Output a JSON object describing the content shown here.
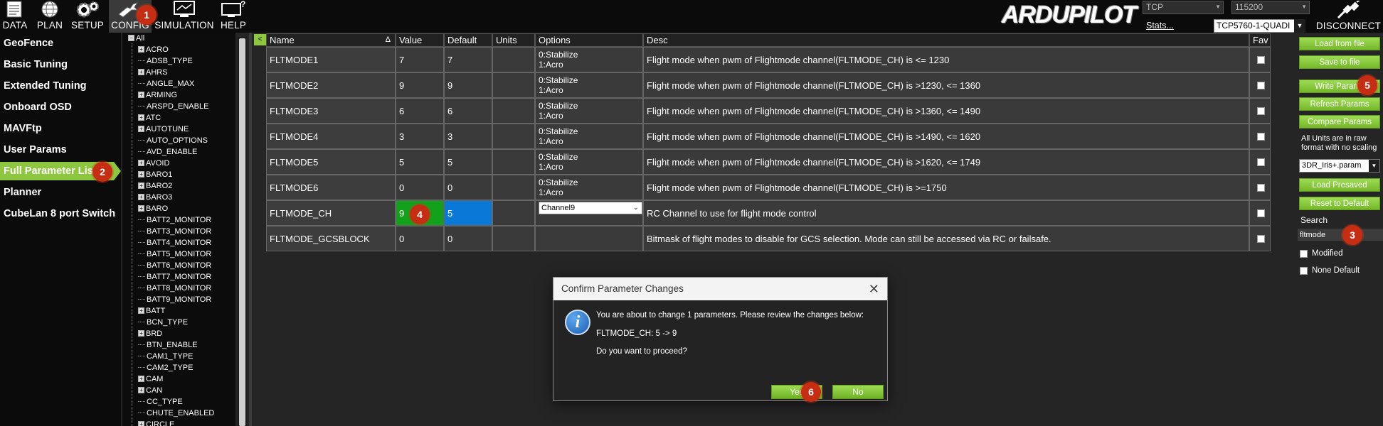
{
  "topbar": {
    "buttons": [
      {
        "label": "DATA",
        "icon": "data-icon"
      },
      {
        "label": "PLAN",
        "icon": "plan-globe-icon"
      },
      {
        "label": "SETUP",
        "icon": "setup-gear-icon"
      },
      {
        "label": "CONFIG",
        "icon": "config-wrench-icon",
        "active": true
      },
      {
        "label": "SIMULATION",
        "icon": "simulation-monitor-icon"
      },
      {
        "label": "HELP",
        "icon": "help-monitor-icon"
      }
    ],
    "logo": "ARDUPILOT",
    "connection_type": "TCP",
    "baud_rate": "115200",
    "stats_link": "Stats...",
    "connection_name": "TCP5760-1-QUADI",
    "disconnect_label": "DISCONNECT"
  },
  "left_menu": {
    "items": [
      {
        "label": "GeoFence"
      },
      {
        "label": "Basic Tuning"
      },
      {
        "label": "Extended Tuning"
      },
      {
        "label": "Onboard OSD"
      },
      {
        "label": "MAVFtp"
      },
      {
        "label": "User Params"
      },
      {
        "label": "Full Parameter List",
        "active": true
      },
      {
        "label": "Planner"
      },
      {
        "label": "CubeLan 8 port Switch"
      }
    ]
  },
  "tree": {
    "root": "All",
    "items": [
      {
        "label": "ACRO",
        "expandable": true
      },
      {
        "label": "ADSB_TYPE",
        "expandable": false
      },
      {
        "label": "AHRS",
        "expandable": true
      },
      {
        "label": "ANGLE_MAX",
        "expandable": false
      },
      {
        "label": "ARMING",
        "expandable": true
      },
      {
        "label": "ARSPD_ENABLE",
        "expandable": false
      },
      {
        "label": "ATC",
        "expandable": true
      },
      {
        "label": "AUTOTUNE",
        "expandable": true
      },
      {
        "label": "AUTO_OPTIONS",
        "expandable": false
      },
      {
        "label": "AVD_ENABLE",
        "expandable": false
      },
      {
        "label": "AVOID",
        "expandable": true
      },
      {
        "label": "BARO1",
        "expandable": true
      },
      {
        "label": "BARO2",
        "expandable": true
      },
      {
        "label": "BARO3",
        "expandable": true
      },
      {
        "label": "BARO",
        "expandable": true
      },
      {
        "label": "BATT2_MONITOR",
        "expandable": false
      },
      {
        "label": "BATT3_MONITOR",
        "expandable": false
      },
      {
        "label": "BATT4_MONITOR",
        "expandable": false
      },
      {
        "label": "BATT5_MONITOR",
        "expandable": false
      },
      {
        "label": "BATT6_MONITOR",
        "expandable": false
      },
      {
        "label": "BATT7_MONITOR",
        "expandable": false
      },
      {
        "label": "BATT8_MONITOR",
        "expandable": false
      },
      {
        "label": "BATT9_MONITOR",
        "expandable": false
      },
      {
        "label": "BATT",
        "expandable": true
      },
      {
        "label": "BCN_TYPE",
        "expandable": false
      },
      {
        "label": "BRD",
        "expandable": true
      },
      {
        "label": "BTN_ENABLE",
        "expandable": false
      },
      {
        "label": "CAM1_TYPE",
        "expandable": false
      },
      {
        "label": "CAM2_TYPE",
        "expandable": false
      },
      {
        "label": "CAM",
        "expandable": true
      },
      {
        "label": "CAN",
        "expandable": true
      },
      {
        "label": "CC_TYPE",
        "expandable": false
      },
      {
        "label": "CHUTE_ENABLED",
        "expandable": false
      },
      {
        "label": "CIRCLE",
        "expandable": true
      }
    ]
  },
  "grid": {
    "corner": "<",
    "columns": [
      "Name",
      "Value",
      "Default",
      "Units",
      "Options",
      "Desc",
      "Fav"
    ],
    "sort_indicator": "Δ",
    "rows": [
      {
        "name": "FLTMODE1",
        "value": "7",
        "default": "7",
        "units": "",
        "options": [
          "0:Stabilize",
          "1:Acro"
        ],
        "desc": "Flight mode when pwm of Flightmode channel(FLTMODE_CH) is <= 1230"
      },
      {
        "name": "FLTMODE2",
        "value": "9",
        "default": "9",
        "units": "",
        "options": [
          "0:Stabilize",
          "1:Acro"
        ],
        "desc": "Flight mode when pwm of Flightmode channel(FLTMODE_CH) is >1230, <= 1360"
      },
      {
        "name": "FLTMODE3",
        "value": "6",
        "default": "6",
        "units": "",
        "options": [
          "0:Stabilize",
          "1:Acro"
        ],
        "desc": "Flight mode when pwm of Flightmode channel(FLTMODE_CH) is >1360, <= 1490"
      },
      {
        "name": "FLTMODE4",
        "value": "3",
        "default": "3",
        "units": "",
        "options": [
          "0:Stabilize",
          "1:Acro"
        ],
        "desc": "Flight mode when pwm of Flightmode channel(FLTMODE_CH) is >1490, <= 1620"
      },
      {
        "name": "FLTMODE5",
        "value": "5",
        "default": "5",
        "units": "",
        "options": [
          "0:Stabilize",
          "1:Acro"
        ],
        "desc": "Flight mode when pwm of Flightmode channel(FLTMODE_CH) is >1620, <= 1749"
      },
      {
        "name": "FLTMODE6",
        "value": "0",
        "default": "0",
        "units": "",
        "options": [
          "0:Stabilize",
          "1:Acro"
        ],
        "desc": "Flight mode when pwm of Flightmode channel(FLTMODE_CH) is >=1750"
      },
      {
        "name": "FLTMODE_CH",
        "value": "9",
        "default": "5",
        "units": "",
        "options_select": "Channel9",
        "desc": "RC Channel to use for flight mode control",
        "modified": true
      },
      {
        "name": "FLTMODE_GCSBLOCK",
        "value": "0",
        "default": "0",
        "units": "",
        "options": [
          "",
          ""
        ],
        "desc": "Bitmask of flight modes to disable for GCS selection. Mode can still be accessed via RC or failsafe."
      }
    ]
  },
  "right_panel": {
    "load_from_file": "Load from file",
    "save_to_file": "Save to file",
    "write_params": "Write Params",
    "refresh_params": "Refresh Params",
    "compare_params": "Compare Params",
    "units_note": "All Units are in raw format with no scaling",
    "param_file": "3DR_Iris+.param",
    "load_presaved": "Load Presaved",
    "reset_to_default": "Reset to Default",
    "search_label": "Search",
    "search_value": "fltmode",
    "modified_label": "Modified",
    "none_default_label": "None Default"
  },
  "dialog": {
    "title": "Confirm Parameter Changes",
    "close": "✕",
    "message": "You are about to change 1 parameters. Please review the changes below:",
    "change": "FLTMODE_CH: 5 -> 9",
    "question": "Do you want to proceed?",
    "yes": "Yes",
    "no": "No"
  },
  "badges": [
    "1",
    "2",
    "3",
    "4",
    "5",
    "6"
  ],
  "colors": {
    "accent_green": "#8dc63f",
    "modified_value": "#12a11a",
    "selected_cell": "#0a78d7",
    "badge_red": "#c62d12"
  }
}
